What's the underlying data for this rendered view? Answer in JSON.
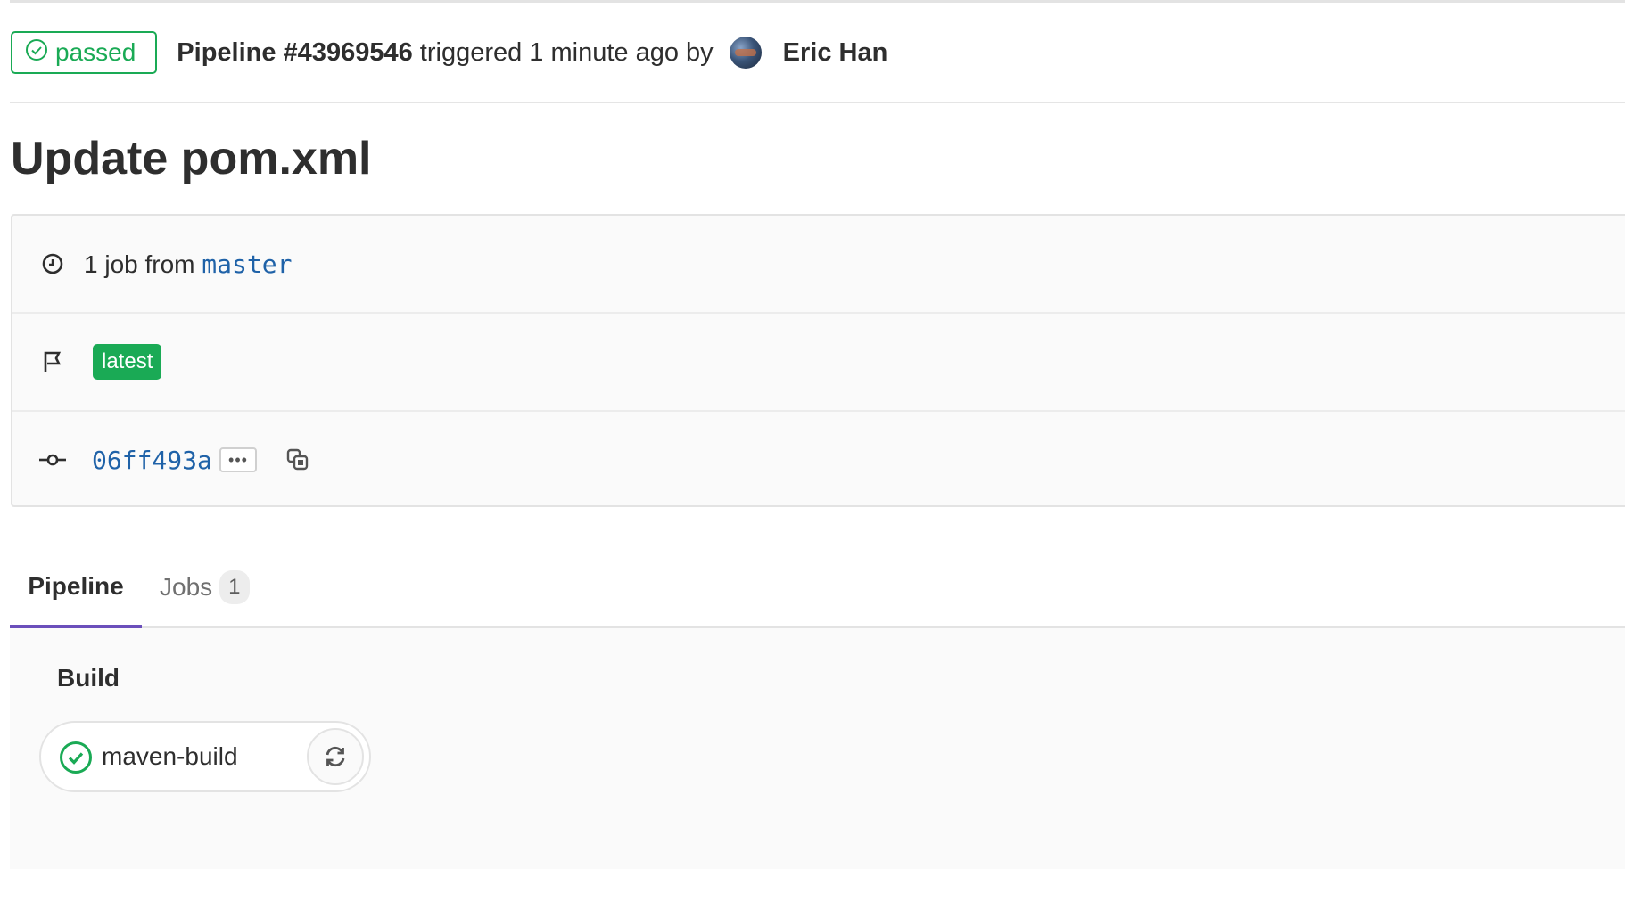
{
  "header": {
    "status": "passed",
    "pipeline_id": "Pipeline #43969546",
    "triggered_text": "triggered 1 minute ago by",
    "author": "Eric Han"
  },
  "commit_title": "Update pom.xml",
  "info": {
    "jobs_text": "1 job from",
    "branch": "master",
    "tag_badge": "latest",
    "sha": "06ff493a",
    "ellipsis": "•••"
  },
  "tabs": {
    "pipeline": "Pipeline",
    "jobs": "Jobs",
    "jobs_count": "1"
  },
  "stage": {
    "name": "Build",
    "job_name": "maven-build",
    "job_status": "success"
  },
  "colors": {
    "success": "#1aaa55",
    "link": "#1f62a8",
    "active_tab": "#6b4fbb"
  },
  "icons": [
    "status-success-icon",
    "clock-icon",
    "flag-icon",
    "commit-icon",
    "ellipsis-icon",
    "copy-icon",
    "retry-icon"
  ]
}
